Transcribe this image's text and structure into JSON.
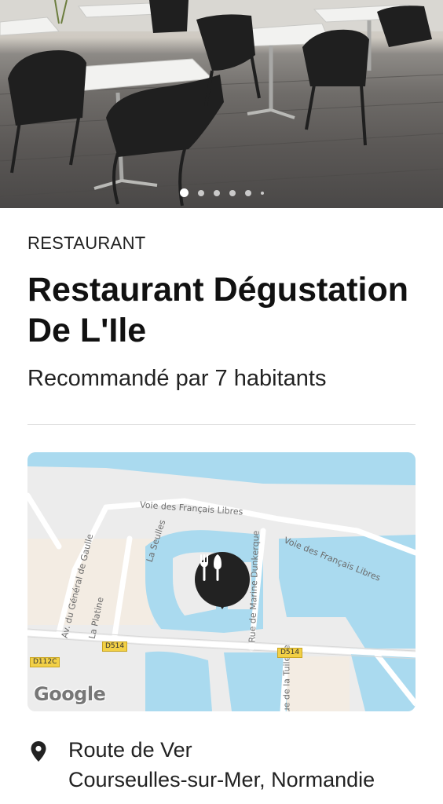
{
  "hero": {
    "image_alt": "Restaurant terrace with tables and chairs",
    "carousel": {
      "total_dots": 6,
      "active_index": 0
    }
  },
  "listing": {
    "category": "RESTAURANT",
    "title": "Restaurant Dégustation De L'Ile",
    "recommendation": "Recommandé par 7 habitants"
  },
  "map": {
    "labels": {
      "road_top_left": "Voie des Français Libres",
      "road_top_right": "Voie des Français Libres",
      "river": "La Seulles",
      "avenue": "Av. du Général de Gaulle",
      "platine": "La Platine",
      "marine": "Rue de Marine Dunkerque",
      "tuilerie": "Rue de la Tuilerie"
    },
    "road_tags": {
      "d514_left": "D514",
      "d514_right": "D514",
      "d112c": "D112C"
    },
    "logo": "Google",
    "pin_icon": "fork-knife-icon"
  },
  "address": {
    "icon": "location-pin-icon",
    "line1": "Route de Ver",
    "line2": "Courseulles-sur-Mer, Normandie"
  },
  "colors": {
    "water": "#aadaef",
    "land": "#ececec",
    "road": "#ffffff",
    "pin": "#222222",
    "text": "#222222"
  }
}
